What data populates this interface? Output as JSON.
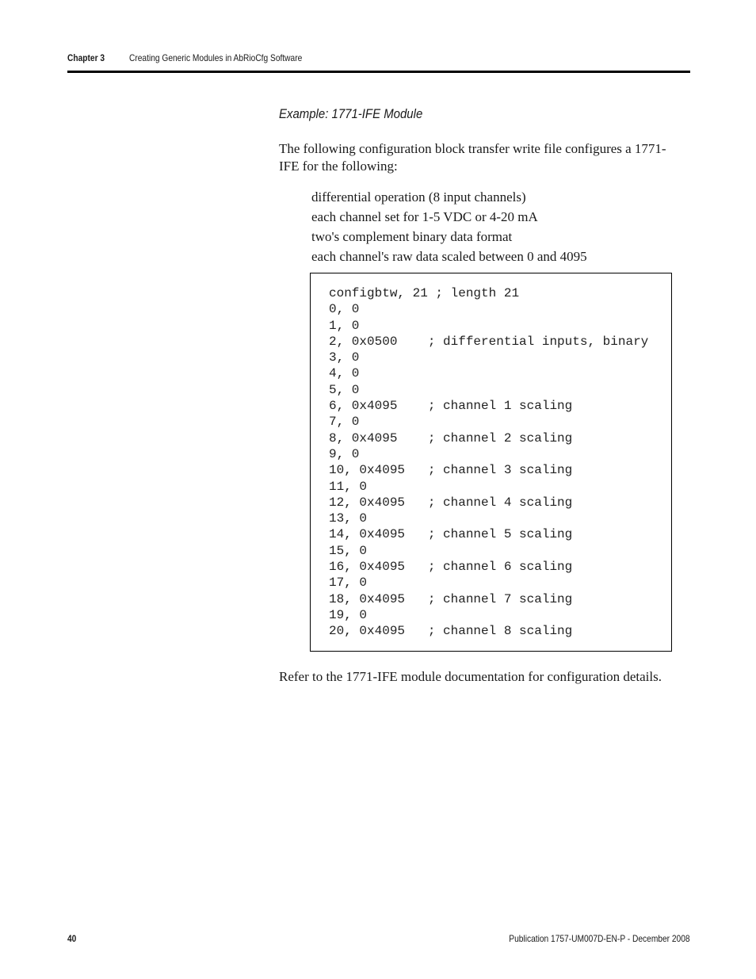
{
  "header": {
    "chapter": "Chapter 3",
    "chapter_title": "Creating Generic Modules in AbRioCfg Software"
  },
  "section": {
    "example_title": "Example: 1771-IFE Module",
    "intro": "The following configuration block transfer write file configures a 1771-IFE for the following:",
    "bullets": [
      "differential operation (8 input channels)",
      "each channel set for 1-5 VDC or 4-20 mA",
      "two's complement binary data format",
      "each channel's raw data scaled between 0 and 4095"
    ],
    "code_lines": [
      "configbtw, 21 ; length 21",
      "0, 0",
      "1, 0",
      "2, 0x0500    ; differential inputs, binary",
      "3, 0",
      "4, 0",
      "5, 0",
      "6, 0x4095    ; channel 1 scaling",
      "7, 0",
      "8, 0x4095    ; channel 2 scaling",
      "9, 0",
      "10, 0x4095   ; channel 3 scaling",
      "11, 0",
      "12, 0x4095   ; channel 4 scaling",
      "13, 0",
      "14, 0x4095   ; channel 5 scaling",
      "15, 0",
      "16, 0x4095   ; channel 6 scaling",
      "17, 0",
      "18, 0x4095   ; channel 7 scaling",
      "19, 0",
      "20, 0x4095   ; channel 8 scaling"
    ],
    "refer": "Refer to the 1771-IFE module documentation for configuration details."
  },
  "footer": {
    "page_number": "40",
    "publication": "Publication 1757-UM007D-EN-P - December 2008"
  }
}
